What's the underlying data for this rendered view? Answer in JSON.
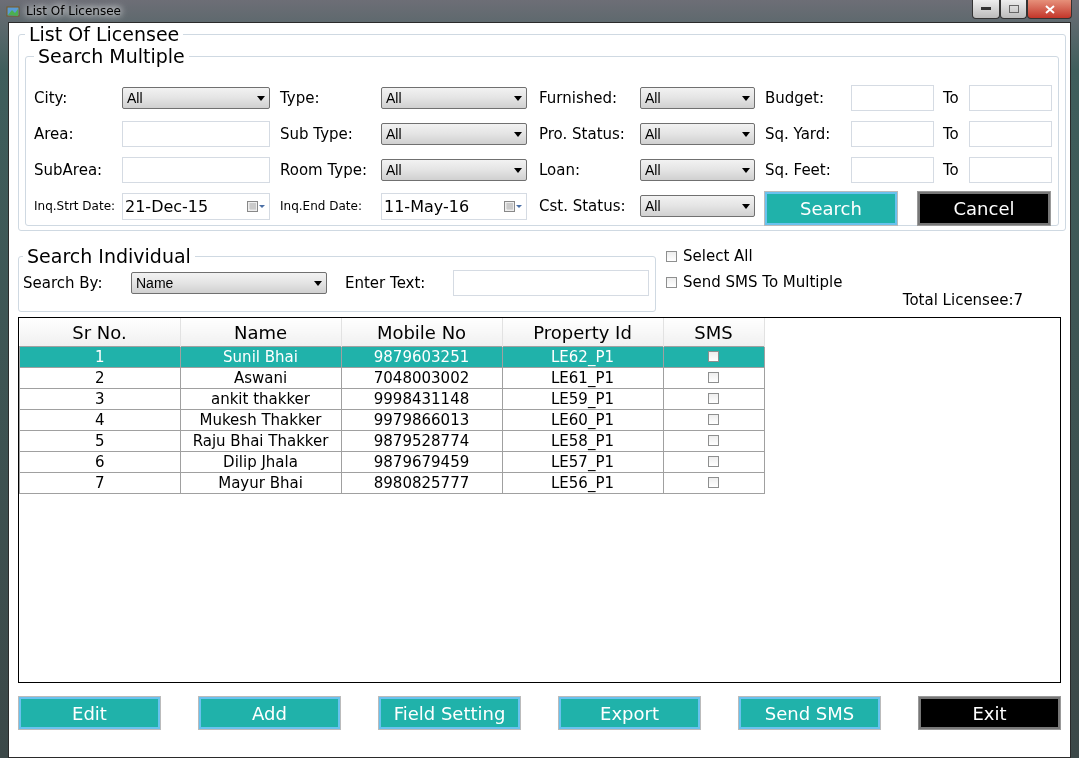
{
  "window": {
    "title": "List Of Licensee"
  },
  "main_group": {
    "legend": "List Of Licensee"
  },
  "search_multiple": {
    "legend": "Search Multiple",
    "rows": [
      {
        "fields": [
          {
            "label": "City:",
            "kind": "select",
            "value": "All"
          },
          {
            "label": "Type:",
            "kind": "select",
            "value": "All"
          },
          {
            "label": "Furnished:",
            "kind": "select",
            "value": "All"
          }
        ],
        "range": {
          "label": "Budget:",
          "to_label": "To"
        }
      },
      {
        "fields": [
          {
            "label": "Area:",
            "kind": "text"
          },
          {
            "label": "Sub Type:",
            "kind": "select",
            "value": "All"
          },
          {
            "label": "Pro. Status:",
            "kind": "select",
            "value": "All"
          }
        ],
        "range": {
          "label": "Sq. Yard:",
          "to_label": "To"
        }
      },
      {
        "fields": [
          {
            "label": "SubArea:",
            "kind": "text"
          },
          {
            "label": "Room Type:",
            "kind": "select",
            "value": "All"
          },
          {
            "label": "Loan:",
            "kind": "select",
            "value": "All"
          }
        ],
        "range": {
          "label": "Sq. Feet:",
          "to_label": "To"
        }
      },
      {
        "fields": [
          {
            "label": "Inq.Strt Date:",
            "kind": "date",
            "value": "21-Dec-15"
          },
          {
            "label": "Inq.End Date:",
            "kind": "date",
            "value": "11-May-16"
          },
          {
            "label": "Cst. Status:",
            "kind": "select",
            "value": "All"
          }
        ]
      }
    ],
    "buttons": [
      {
        "label": "Search",
        "kind": "primary"
      },
      {
        "label": "Cancel",
        "kind": "dark"
      }
    ]
  },
  "search_individual": {
    "legend": "Search Individual",
    "search_by_label": "Search By:",
    "search_by_value": "Name",
    "enter_text_label": "Enter Text:"
  },
  "options": [
    {
      "label": "Select All",
      "checked": false
    },
    {
      "label": "Send SMS To Multiple",
      "checked": false
    }
  ],
  "total": "Total Licensee:7",
  "table": {
    "columns": [
      "Sr No.",
      "Name",
      "Mobile No",
      "Property Id",
      "SMS"
    ],
    "rows": [
      {
        "sr": "1",
        "name": "Sunil Bhai",
        "mobile": "9879603251",
        "property_id": "LE62_P1",
        "sms": false,
        "selected": true
      },
      {
        "sr": "2",
        "name": "Aswani",
        "mobile": "7048003002",
        "property_id": "LE61_P1",
        "sms": false,
        "selected": false
      },
      {
        "sr": "3",
        "name": "ankit thakker",
        "mobile": "9998431148",
        "property_id": "LE59_P1",
        "sms": false,
        "selected": false
      },
      {
        "sr": "4",
        "name": "Mukesh Thakker",
        "mobile": "9979866013",
        "property_id": "LE60_P1",
        "sms": false,
        "selected": false
      },
      {
        "sr": "5",
        "name": "Raju Bhai Thakker",
        "mobile": "9879528774",
        "property_id": "LE58_P1",
        "sms": false,
        "selected": false
      },
      {
        "sr": "6",
        "name": "Dilip Jhala",
        "mobile": "9879679459",
        "property_id": "LE57_P1",
        "sms": false,
        "selected": false
      },
      {
        "sr": "7",
        "name": "Mayur Bhai",
        "mobile": "8980825777",
        "property_id": "LE56_P1",
        "sms": false,
        "selected": false
      }
    ]
  },
  "bottom_buttons": [
    {
      "label": "Edit",
      "kind": "primary"
    },
    {
      "label": "Add",
      "kind": "primary"
    },
    {
      "label": "Field Setting",
      "kind": "primary"
    },
    {
      "label": "Export",
      "kind": "primary"
    },
    {
      "label": "Send SMS",
      "kind": "primary"
    },
    {
      "label": "Exit",
      "kind": "dark"
    }
  ]
}
